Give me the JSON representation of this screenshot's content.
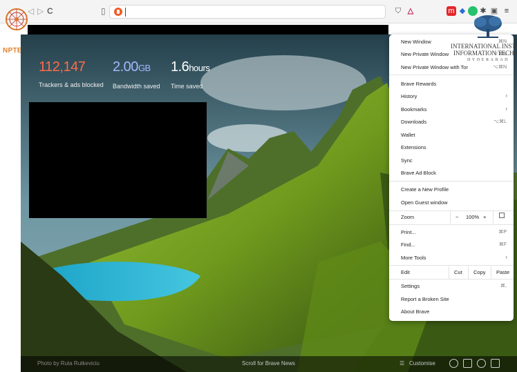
{
  "browser": {
    "accent_colors": {
      "brave_orange": "#f25c26",
      "menu_text": "#222222"
    },
    "nav_icons": [
      "back-icon",
      "forward-icon",
      "reload-icon",
      "bookmark-icon",
      "brave-shields-icon"
    ],
    "toolbar_icons": [
      "brave-shield-icon",
      "brave-rewards-icon",
      "extension-icons",
      "menu-icon"
    ]
  },
  "logos": {
    "nptel": "NPTEL",
    "iiit_line1": "INTERNATIONAL INSTITUTE",
    "iiit_line2": "INFORMATION TECHNOLO",
    "iiit_line3": "HYDERABAD"
  },
  "stats": {
    "trackers": {
      "value": "112,147",
      "label": "Trackers & ads blocked",
      "color": "#ff6b4a"
    },
    "bandwidth": {
      "value": "2.00",
      "unit": "GB",
      "label": "Bandwidth saved",
      "color": "#a6b8ff"
    },
    "time": {
      "value": "1.6",
      "unit": "hours",
      "label": "Time saved",
      "color": "#ffffff"
    }
  },
  "bottom_bar": {
    "photo_credit": "Photo by Ruta Rutkeviciu",
    "scroll_label": "Scroll for Brave News",
    "customise_label": "Customise"
  },
  "menu": {
    "new_window": {
      "label": "New Window",
      "shortcut": "⌘N"
    },
    "new_private_window": {
      "label": "New Private Window",
      "shortcut": "⇧⌘N"
    },
    "new_private_window_tor": {
      "label": "New Private Window with Tor",
      "shortcut": "⌥⌘N"
    },
    "brave_rewards": "Brave Rewards",
    "history": "History",
    "bookmarks": "Bookmarks",
    "downloads": {
      "label": "Downloads",
      "shortcut": "⌥⌘L"
    },
    "wallet": "Wallet",
    "extensions": "Extensions",
    "sync": "Sync",
    "brave_ad_block": "Brave Ad Block",
    "create_profile": "Create a New Profile",
    "open_guest": "Open Guest window",
    "zoom": {
      "label": "Zoom",
      "minus": "−",
      "value": "100%",
      "plus": "+"
    },
    "print": {
      "label": "Print...",
      "shortcut": "⌘P"
    },
    "find": {
      "label": "Find...",
      "shortcut": "⌘F"
    },
    "more_tools": "More Tools",
    "edit": {
      "label": "Edit",
      "cut": "Cut",
      "copy": "Copy",
      "paste": "Paste"
    },
    "settings": {
      "label": "Settings",
      "shortcut": "⌘,"
    },
    "report_broken_site": "Report a Broken Site",
    "about_brave": "About Brave"
  }
}
